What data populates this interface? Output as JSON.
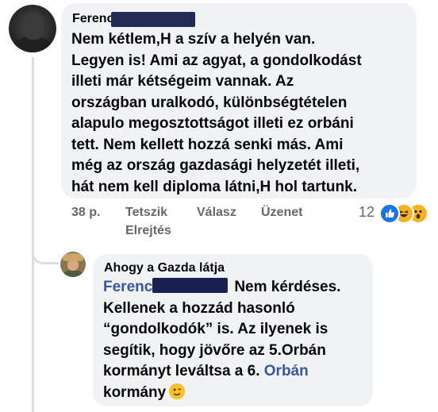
{
  "comment": {
    "author_first": "Ferenc",
    "text": "Nem kétlem,H a szív a helyén van.\nLegyen is! Ami az agyat, a gondolkodást\nilleti már kétségeim vannak. Az\nországban uralkodó, különbségtételen\nalapulo megosztottságot illeti ez orbáni\ntett. Nem kellett hozzá senki más. Ami\nmég az ország gazdasági helyzetét illeti,\nhát nem kell diploma látni,H hol tartunk.",
    "time": "38 p.",
    "like_label": "Tetszik",
    "reply_label": "Válasz",
    "message_label": "Üzenet",
    "hide_label": "Elrejtés",
    "reaction_count": "12",
    "reaction_icons": [
      "like-icon",
      "haha-icon",
      "wow-icon"
    ]
  },
  "reply": {
    "author": "Ahogy a Gazda látja",
    "mention_name": "Ferenc",
    "text_1": "Nem kérdéses.\nKellenek a hozzád hasonló\n“gondolkodók” is. Az ilyenek is\nsegítik, hogy jövőre az 5.Orbán\nkormányt leváltsa a 6. ",
    "mention_2": "Orbán",
    "text_2": "\nkormány",
    "emoji": "wink-emoji"
  },
  "colors": {
    "bubble": "#f0f2f5",
    "mention": "#385898",
    "meta": "#65676b",
    "like_blue": "#1b74e4"
  }
}
